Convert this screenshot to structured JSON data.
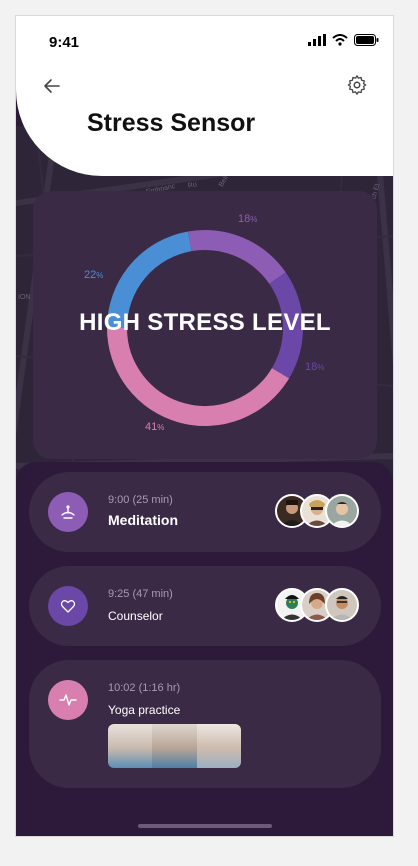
{
  "status_bar": {
    "time": "9:41"
  },
  "header": {
    "title": "Stress Sensor"
  },
  "stress_chart": {
    "label": "HIGH STRESS LEVEL",
    "segments": [
      {
        "pct": "18",
        "unit": "%",
        "color": "#8d5cb5"
      },
      {
        "pct": "18",
        "unit": "%",
        "color": "#6b47a8"
      },
      {
        "pct": "41",
        "unit": "%",
        "color": "#d97fb0"
      },
      {
        "pct": "22",
        "unit": "%",
        "color": "#4a8fd6"
      }
    ]
  },
  "map_labels": [
    "mens",
    "Embrianc",
    "Ru",
    "Bell",
    "ch Et",
    "ION"
  ],
  "activities": [
    {
      "time": "9:00 (25 min)",
      "name": "Meditation",
      "icon": "meditation-icon",
      "icon_color": "#8d5cb5"
    },
    {
      "time": "9:25 (47 min)",
      "name": "Counselor",
      "icon": "heart-icon",
      "icon_color": "#6b47a8"
    },
    {
      "time": "10:02 (1:16 hr)",
      "name": "Yoga practice",
      "icon": "pulse-icon",
      "icon_color": "#d97fb0"
    }
  ]
}
